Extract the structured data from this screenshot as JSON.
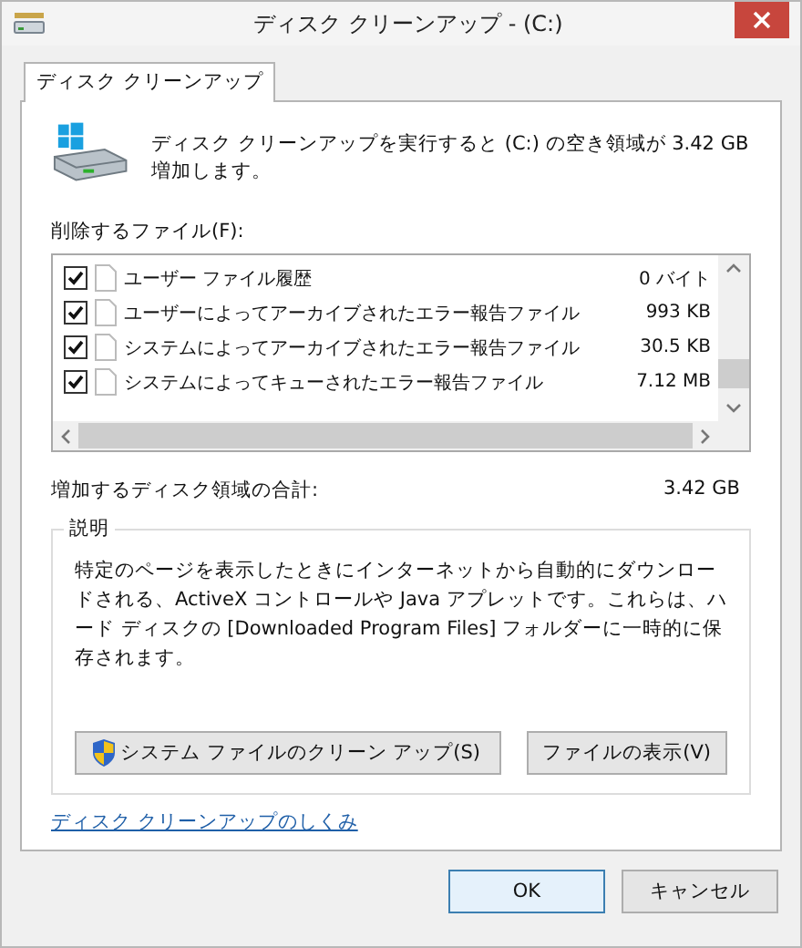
{
  "window": {
    "title": "ディスク クリーンアップ - (C:)"
  },
  "tabs": [
    {
      "label": "ディスク クリーンアップ",
      "selected": true
    }
  ],
  "summary": "ディスク クリーンアップを実行すると (C:) の空き領域が 3.42 GB 増加します。",
  "files_label": "削除するファイル(F):",
  "files": [
    {
      "name": "ユーザー ファイル履歴",
      "size": "0 バイト",
      "checked": true
    },
    {
      "name": "ユーザーによってアーカイブされたエラー報告ファイル",
      "size": "993 KB",
      "checked": true
    },
    {
      "name": "システムによってアーカイブされたエラー報告ファイル",
      "size": "30.5 KB",
      "checked": true
    },
    {
      "name": "システムによってキューされたエラー報告ファイル",
      "size": "7.12 MB",
      "checked": true
    }
  ],
  "total": {
    "label": "増加するディスク領域の合計:",
    "value": "3.42 GB"
  },
  "description": {
    "title": "説明",
    "text": "特定のページを表示したときにインターネットから自動的にダウンロードされる、ActiveX コントロールや Java アプレットです。これらは、ハード ディスクの [Downloaded Program Files] フォルダーに一時的に保存されます。"
  },
  "buttons": [
    {
      "label": "システム ファイルのクリーン アップ(S)",
      "kind": "shield"
    },
    {
      "label": "ファイルの表示(V)",
      "kind": "plain"
    }
  ],
  "link": "ディスク クリーンアップのしくみ",
  "dialog_buttons": [
    {
      "label": "OK",
      "default": true
    },
    {
      "label": "キャンセル",
      "default": false
    }
  ]
}
